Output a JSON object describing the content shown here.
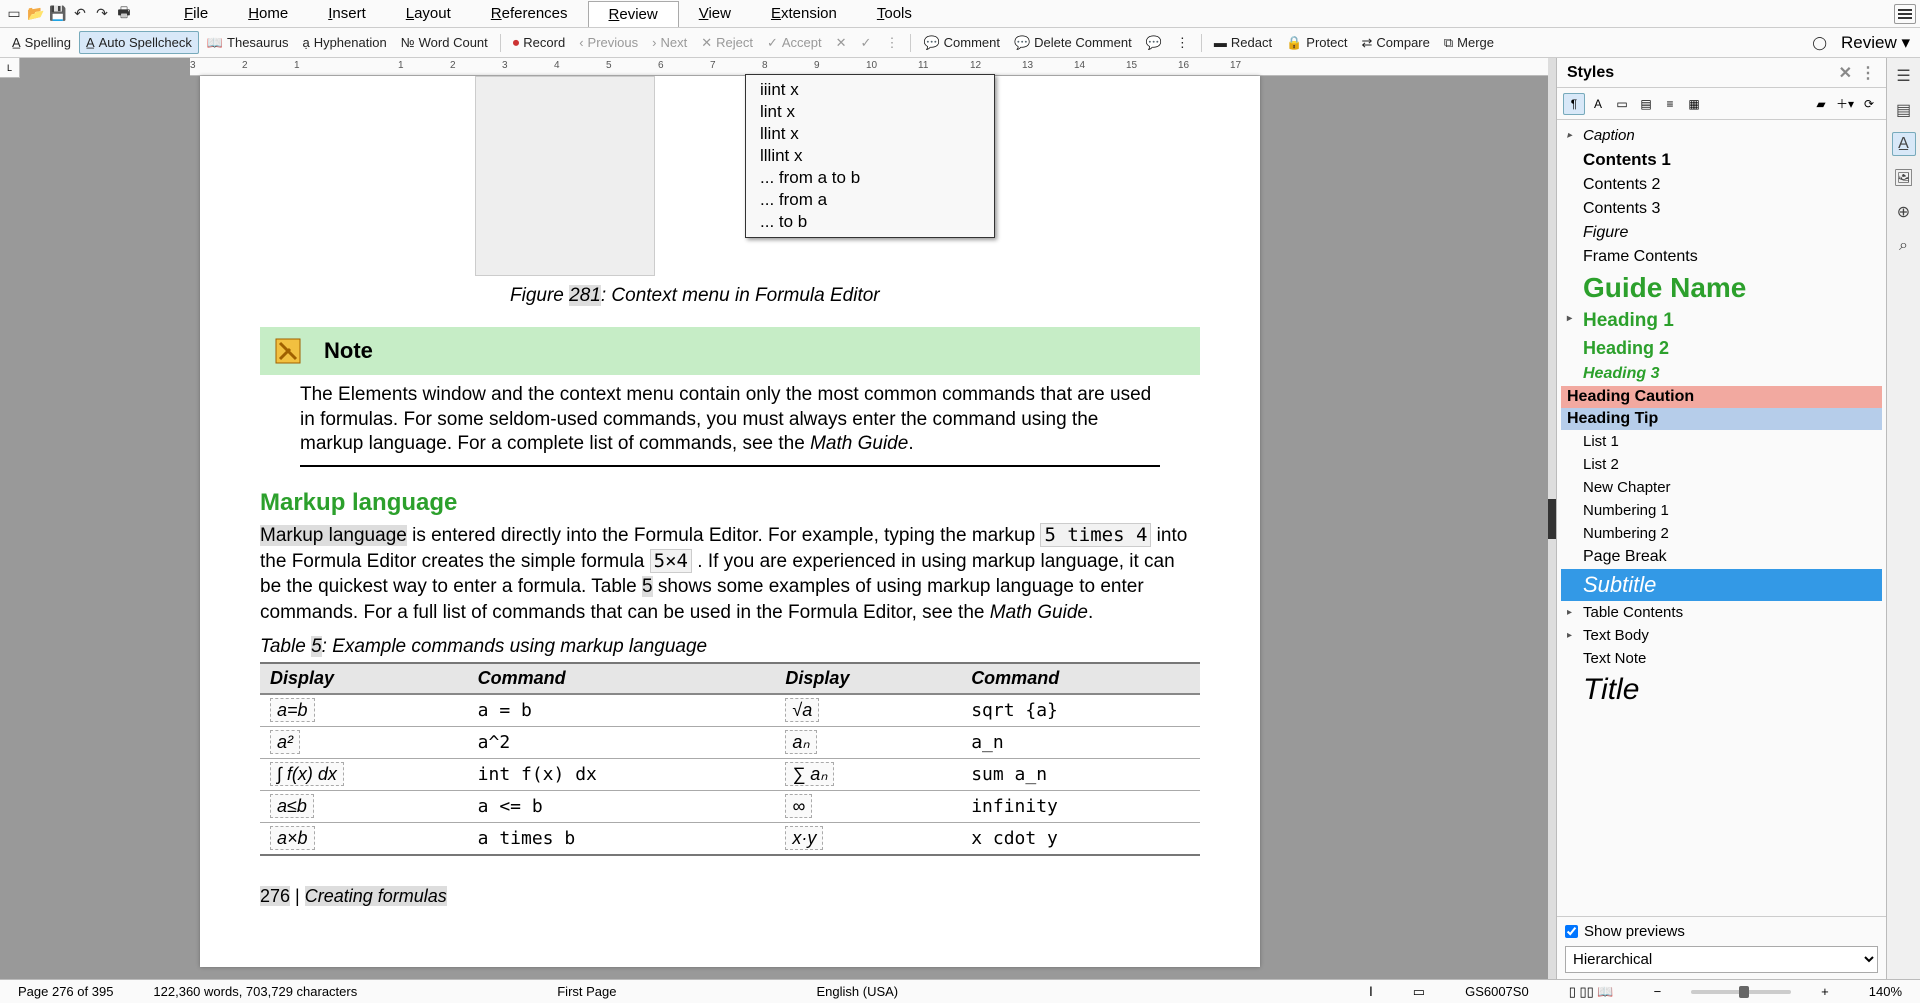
{
  "menubar": {
    "items": [
      "File",
      "Home",
      "Insert",
      "Layout",
      "References",
      "Review",
      "View",
      "Extension",
      "Tools"
    ],
    "active": 5
  },
  "toolbar": {
    "spelling": "Spelling",
    "autospell": "Auto Spellcheck",
    "thesaurus": "Thesaurus",
    "hyphenation": "Hyphenation",
    "wordcount": "Word Count",
    "record": "Record",
    "previous": "Previous",
    "next": "Next",
    "reject": "Reject",
    "accept": "Accept",
    "comment": "Comment",
    "delcomment": "Delete Comment",
    "redact": "Redact",
    "protect": "Protect",
    "compare": "Compare",
    "merge": "Merge",
    "review": "Review"
  },
  "ruler": {
    "ticks": [
      "3",
      "2",
      "1",
      "",
      "1",
      "2",
      "3",
      "4",
      "5",
      "6",
      "7",
      "8",
      "9",
      "10",
      "11",
      "12",
      "13",
      "14",
      "15",
      "16",
      "17"
    ]
  },
  "ctx": {
    "items": [
      "iiint x",
      "lint x",
      "llint x",
      "lllint x",
      "... from a to b",
      "... from a",
      "... to b"
    ]
  },
  "caption1_pre": "Figure ",
  "caption1_num": "281",
  "caption1_post": ": Context menu in Formula Editor",
  "note": {
    "title": "Note",
    "text_a": "The Elements window and the context menu contain only the most common commands that are used in formulas. For some seldom-used commands, you must always enter the command using the markup language. For a complete list of commands, see the ",
    "text_b": "Math Guide",
    "text_c": "."
  },
  "h2": "Markup language",
  "body": {
    "p1a": "Markup language",
    "p1b": " is entered directly into the Formula Editor. For example, typing the markup ",
    "p1c": "5 times 4",
    "p1d": " into the Formula Editor creates the simple formula ",
    "p1e": "5×4",
    "p1f": " . If you are experienced in using markup language, it can be the quickest way to enter a formula. Table ",
    "p1g": "5",
    "p1h": " shows some examples of using markup language to enter commands. For a full list of commands that can be used in the Formula Editor, see the ",
    "p1i": "Math Guide",
    "p1j": "."
  },
  "table_caption_pre": "Table ",
  "table_caption_num": "5",
  "table_caption_post": ": Example commands using markup language",
  "table": {
    "headers": [
      "Display",
      "Command",
      "Display",
      "Command"
    ],
    "rows": [
      {
        "d1": "a=b",
        "c1": "a = b",
        "d2": "√a",
        "c2": "sqrt {a}"
      },
      {
        "d1": "a²",
        "c1": "a^2",
        "d2": "aₙ",
        "c2": "a_n"
      },
      {
        "d1": "∫ f(x) dx",
        "c1": "int f(x) dx",
        "d2": "∑ aₙ",
        "c2": "sum a_n"
      },
      {
        "d1": "a≤b",
        "c1": "a <= b",
        "d2": "∞",
        "c2": "infinity"
      },
      {
        "d1": "a×b",
        "c1": "a times b",
        "d2": "x·y",
        "c2": "x cdot y"
      }
    ]
  },
  "footer": {
    "num": "276",
    "sep": " | ",
    "title": "Creating formulas"
  },
  "styles": {
    "title": "Styles",
    "show_previews": "Show previews",
    "mode": "Hierarchical",
    "items": [
      {
        "label": "Caption",
        "style": "font-style:italic;font-size:15px;",
        "exp": true
      },
      {
        "label": "Contents 1",
        "style": "font-weight:bold;font-size:17px;"
      },
      {
        "label": "Contents 2",
        "style": "font-size:16px;"
      },
      {
        "label": "Contents 3",
        "style": "font-size:16px;"
      },
      {
        "label": "Figure",
        "style": "font-style:italic;font-size:16px;"
      },
      {
        "label": "Frame Contents",
        "style": "font-family:serif;font-size:16px;"
      },
      {
        "label": "Guide Name",
        "style": "color:#2ca02c;font-size:28px;font-weight:bold;"
      },
      {
        "label": "Heading 1",
        "style": "color:#2ca02c;font-size:19px;font-weight:bold;",
        "exp": true
      },
      {
        "label": "Heading 2",
        "style": "color:#2ca02c;font-size:18px;font-weight:bold;"
      },
      {
        "label": "Heading 3",
        "style": "color:#2ca02c;font-style:italic;font-size:16px;font-weight:bold;"
      },
      {
        "label": "Heading Caution",
        "style": "background:#f2a9a0;font-size:16px;font-weight:bold;padding:2px 6px;"
      },
      {
        "label": "Heading Tip",
        "style": "background:#b6cdea;font-size:16px;font-weight:bold;padding:2px 6px;"
      },
      {
        "label": "List 1",
        "style": "font-size:15px;"
      },
      {
        "label": "List 2",
        "style": "font-size:15px;"
      },
      {
        "label": "New Chapter",
        "style": "font-size:15px;"
      },
      {
        "label": "Numbering 1",
        "style": "font-size:15px;"
      },
      {
        "label": "Numbering 2",
        "style": "font-size:15px;"
      },
      {
        "label": "Page Break",
        "style": "font-family:serif;font-size:16px;"
      },
      {
        "label": "Subtitle",
        "style": "font-style:italic;font-size:22px;",
        "selected": true
      },
      {
        "label": "Table Contents",
        "style": "font-size:15px;",
        "exp": true
      },
      {
        "label": "Text Body",
        "style": "font-size:15px;",
        "exp": true
      },
      {
        "label": "Text Note",
        "style": "font-size:15px;"
      },
      {
        "label": "Title",
        "style": "font-family:serif;font-size:30px;font-style:italic;"
      }
    ]
  },
  "statusbar": {
    "page": "Page 276 of 395",
    "words": "122,360 words, 703,729 characters",
    "pgstyle": "First Page",
    "lang": "English (USA)",
    "doc": "GS6007S0",
    "zoom": "140%"
  }
}
